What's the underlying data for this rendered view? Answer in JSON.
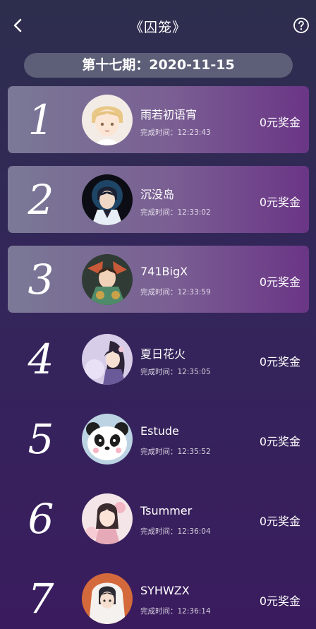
{
  "header": {
    "title": "《囚笼》"
  },
  "period": {
    "label": "第十七期：2020-11-15"
  },
  "colors": {
    "top_row_gradient_start": "#7a7996",
    "top_row_gradient_end": "#6a3586",
    "background": "#33265a"
  },
  "icons": {
    "back": "chevron-left-icon",
    "help": "question-circle-icon"
  },
  "ranks": [
    {
      "rank": "1",
      "name": "雨若初语宵",
      "time": "完成时间：12:23:43",
      "prize": "0元奖金",
      "avatar": "anime-boy-blond"
    },
    {
      "rank": "2",
      "name": "沉没岛",
      "time": "完成时间：12:33:02",
      "prize": "0元奖金",
      "avatar": "anime-boy-dark"
    },
    {
      "rank": "3",
      "name": "741BigX",
      "time": "完成时间：12:33:59",
      "prize": "0元奖金",
      "avatar": "anime-warrior-green"
    },
    {
      "rank": "4",
      "name": "夏日花火",
      "time": "完成时间：12:35:05",
      "prize": "0元奖金",
      "avatar": "anime-girl-purple"
    },
    {
      "rank": "5",
      "name": "Estude",
      "time": "完成时间：12:35:52",
      "prize": "0元奖金",
      "avatar": "panda"
    },
    {
      "rank": "6",
      "name": "Tsummer",
      "time": "完成时间：12:36:04",
      "prize": "0元奖金",
      "avatar": "anime-girl-pink"
    },
    {
      "rank": "7",
      "name": "SYHWZX",
      "time": "完成时间：12:36:14",
      "prize": "0元奖金",
      "avatar": "anime-girl-white-hood"
    }
  ]
}
